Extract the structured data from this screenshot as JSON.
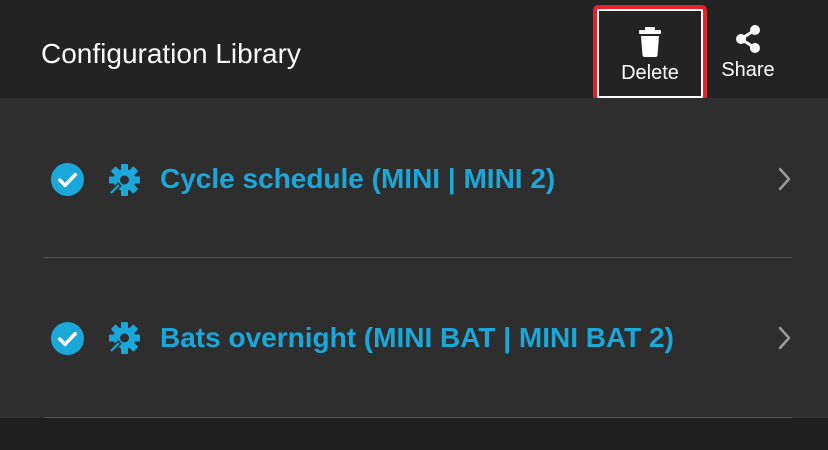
{
  "header": {
    "title": "Configuration Library",
    "actions": {
      "delete_label": "Delete",
      "delete_icon": "trash-icon",
      "share_label": "Share",
      "share_icon": "share-icon"
    }
  },
  "list": {
    "items": [
      {
        "label": "Cycle schedule (MINI | MINI 2)",
        "selected": true,
        "icon": "cog-edit-icon"
      },
      {
        "label": "Bats overnight (MINI BAT | MINI BAT 2)",
        "selected": true,
        "icon": "cog-edit-icon"
      }
    ]
  },
  "colors": {
    "accent": "#1aa7d9",
    "highlight_border": "#e8202a",
    "background": "#2e2e2e",
    "header_background": "#232323"
  }
}
